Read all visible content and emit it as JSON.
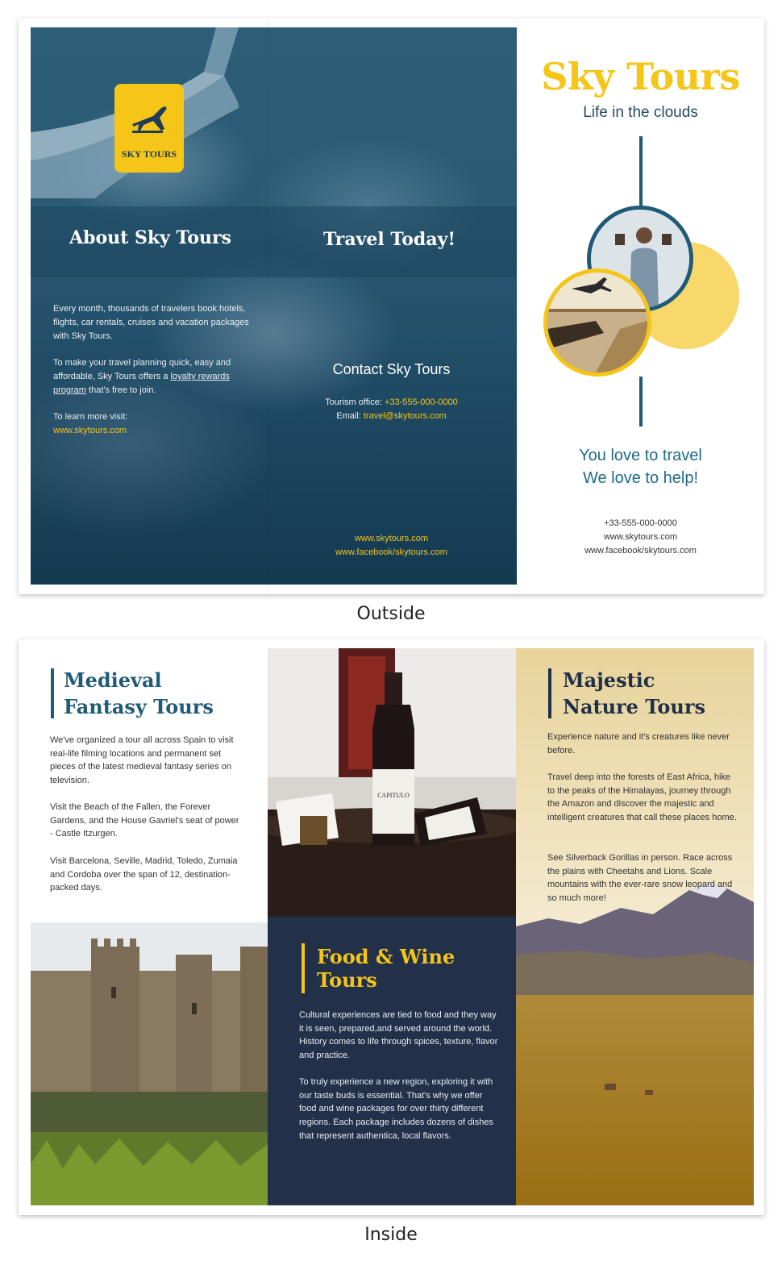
{
  "outside": {
    "logo_text": "SKY TOURS",
    "about": {
      "heading": "About Sky Tours",
      "p1": "Every month, thousands of travelers book hotels, flights, car rentals, cruises and vacation packages with Sky Tours.",
      "p2_a": "To make your travel planning quick, easy and affordable, Sky Tours offers a ",
      "p2_link": "loyalty rewards program",
      "p2_b": " that's free to join.",
      "p3": "To learn more visit:",
      "url": "www.skytours.com"
    },
    "travel": {
      "heading": "Travel Today!",
      "contact_heading": "Contact Sky Tours",
      "office_label": "Tourism office: ",
      "office_phone": "+33-555-000-0000",
      "email_label": "Email: ",
      "email": "travel@skytours.com",
      "web": "www.skytours.com",
      "facebook": "www.facebook/skytours.com"
    },
    "cover": {
      "title": "Sky Tours",
      "subtitle": "Life in the clouds",
      "tagline_1": "You love to travel",
      "tagline_2": "We love to help!",
      "phone": "+33-555-000-0000",
      "web": "www.skytours.com",
      "facebook": "www.facebook/skytours.com"
    }
  },
  "inside": {
    "medieval": {
      "heading_1": "Medieval",
      "heading_2": "Fantasy Tours",
      "p1": "We've organized a tour all across Spain to visit real-life filming locations and permanent set pieces of the latest medieval fantasy series on television.",
      "p2": "Visit the Beach of the Fallen, the Forever Gardens, and the House Gavriel's seat of power - Castle Itzurgen.",
      "p3": "Visit Barcelona, Seville, Madrid, Toledo, Zumaia and Cordoba over the span of 12, destination-packed days."
    },
    "food": {
      "heading_1": "Food & Wine",
      "heading_2": "Tours",
      "label": "CAPITULO",
      "p1": "Cultural experiences are tied to food and they way it is seen, prepared,and served around the world. History comes to life through spices, texture, flavor and practice.",
      "p2": "To truly experience a new region, exploring it with our taste buds is essential. That's why we offer food and wine packages for over thirty different regions. Each package includes dozens of dishes that represent authentica, local flavors."
    },
    "nature": {
      "heading_1": "Majestic",
      "heading_2": "Nature Tours",
      "p1": "Experience nature and it's creatures like never before.",
      "p2": "Travel deep into the forests of East Africa, hike to the peaks of the Himalayas, journey through the Amazon and discover the majestic and intelligent creatures that call these places home.",
      "p3": "See Silverback Gorillas in person. Race across the plains with Cheetahs and Lions. Scale mountains with the ever-rare snow leopard and so much more!"
    }
  },
  "captions": {
    "outside": "Outside",
    "inside": "Inside"
  },
  "colors": {
    "yellow": "#f5c518",
    "teal": "#1f5a78",
    "navy": "#22304a"
  }
}
